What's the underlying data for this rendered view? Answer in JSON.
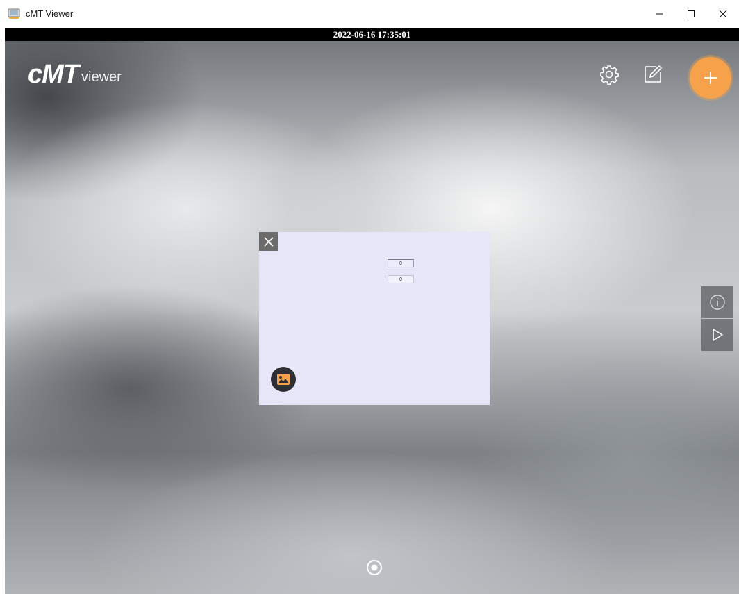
{
  "window": {
    "title": "cMT Viewer",
    "controls": [
      "minimize",
      "maximize",
      "close"
    ]
  },
  "statusbar": {
    "datetime": "2022-06-16 17:35:01"
  },
  "logo": {
    "mark": "cMT",
    "sub": "viewer"
  },
  "toolbar": {
    "icons": [
      "gear-icon",
      "edit-icon",
      "plus-icon"
    ],
    "accent_color": "#f6a24a"
  },
  "preview": {
    "field_1": "0",
    "field_2": "0",
    "icons": [
      "close-icon",
      "image-icon"
    ]
  },
  "side_panel": {
    "icons": [
      "info-icon",
      "play-icon"
    ]
  },
  "colors": {
    "datebar": "#000000",
    "card": "#e6e6f8"
  }
}
